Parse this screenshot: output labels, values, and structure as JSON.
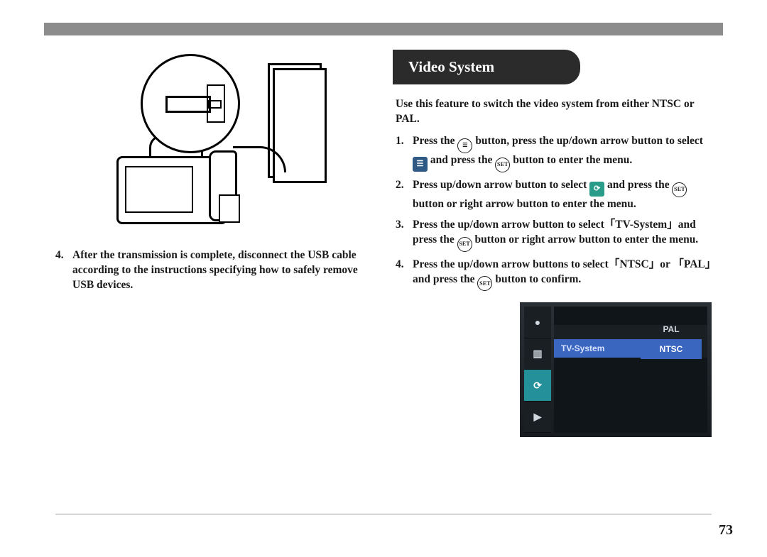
{
  "page_number": "73",
  "left": {
    "step4_num": "4.",
    "step4_text": "After the transmission is complete, disconnect the USB cable according to the instructions specifying how to safely remove USB devices."
  },
  "right": {
    "heading": "Video System",
    "intro": "Use this feature to switch the video system from either NTSC or PAL.",
    "step1_num": "1.",
    "step1_a": "Press the ",
    "step1_b": " button, press the up/down arrow button to select ",
    "step1_c": " and press the ",
    "step1_d": " button to enter the menu.",
    "step2_num": "2.",
    "step2_a": "Press up/down arrow button to select ",
    "step2_b": " and press the ",
    "step2_c": " button or right arrow button to enter the menu.",
    "step3_num": "3.",
    "step3_text": "Press the up/down arrow button to select「TV-System」and press the ",
    "step3_b": " button or right arrow button to enter the menu.",
    "step4_num": "4.",
    "step4_a": "Press the up/down arrow buttons to select「NTSC」or 「PAL」and press the ",
    "step4_b": " button to confirm.",
    "set_label": "SET"
  },
  "menu": {
    "tab_camera": "●",
    "tab_movie": "▥",
    "tab_setup": "⟳",
    "tab_play": "▶",
    "row_label": "TV-System",
    "opt_pal": "PAL",
    "opt_ntsc": "NTSC"
  }
}
